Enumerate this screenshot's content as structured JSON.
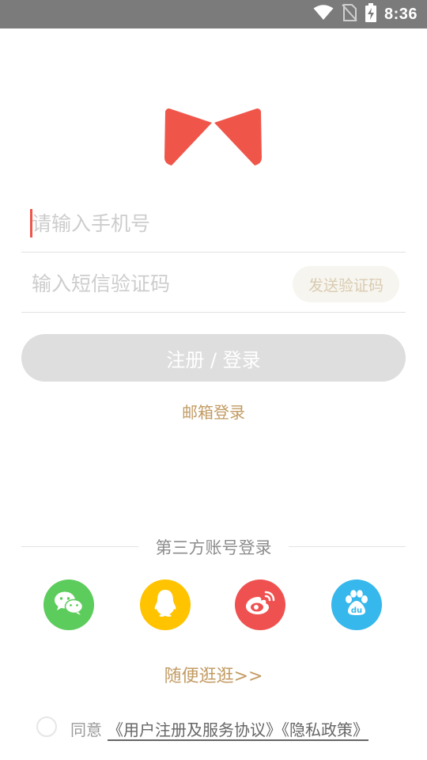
{
  "status_bar": {
    "time": "8:36",
    "icons": [
      "wifi-icon",
      "no-sim-icon",
      "battery-charging-icon"
    ]
  },
  "logo": {
    "name": "bow-tie-logo",
    "color": "#f0554a"
  },
  "phone_field": {
    "placeholder": "请输入手机号",
    "value": ""
  },
  "code_field": {
    "placeholder": "输入短信验证码",
    "value": "",
    "send_label": "发送验证码"
  },
  "login_button": {
    "label": "注册 / 登录"
  },
  "email_login": {
    "label": "邮箱登录"
  },
  "third_party": {
    "title": "第三方账号登录",
    "providers": [
      {
        "name": "wechat",
        "icon": "wechat-icon",
        "color": "#5ccc5c"
      },
      {
        "name": "qq",
        "icon": "qq-icon",
        "color": "#ffc300"
      },
      {
        "name": "weibo",
        "icon": "weibo-icon",
        "color": "#ef5150"
      },
      {
        "name": "baidu",
        "icon": "baidu-icon",
        "color": "#36b8ec"
      }
    ]
  },
  "browse_link": {
    "label": "随便逛逛>>"
  },
  "agreement": {
    "prefix": "同意",
    "terms": "《用户注册及服务协议》《隐私政策》",
    "checked": false
  },
  "colors": {
    "accent": "#c29b63",
    "brand_red": "#f0554a",
    "button_disabled": "#dedede"
  }
}
